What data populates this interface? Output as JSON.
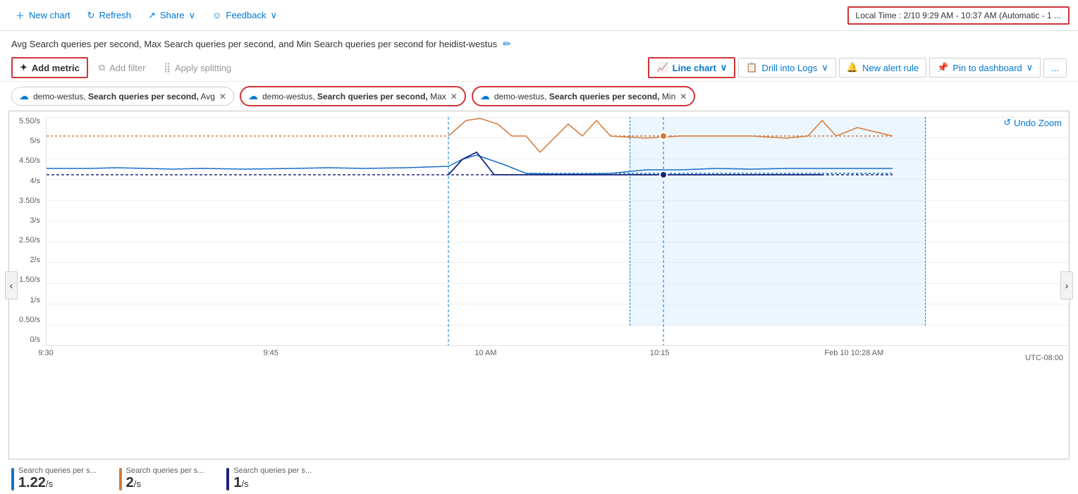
{
  "toolbar": {
    "new_chart": "New chart",
    "refresh": "Refresh",
    "share": "Share",
    "feedback": "Feedback",
    "time_range": "Local Time : 2/10 9:29 AM - 10:37 AM (Automatic - 1 ..."
  },
  "title": {
    "text": "Avg Search queries per second, Max Search queries per second, and Min Search queries per second for heidist-westus",
    "edit_icon": "✏"
  },
  "metrics_toolbar": {
    "add_metric": "Add metric",
    "add_filter": "Add filter",
    "apply_splitting": "Apply splitting",
    "line_chart": "Line chart",
    "drill_into_logs": "Drill into Logs",
    "new_alert_rule": "New alert rule",
    "pin_to_dashboard": "Pin to dashboard",
    "more": "..."
  },
  "metric_tags": [
    {
      "resource": "demo-westus",
      "metric": "Search queries per second",
      "agg": "Avg",
      "highlighted": false
    },
    {
      "resource": "demo-westus",
      "metric": "Search queries per second",
      "agg": "Max",
      "highlighted": true
    },
    {
      "resource": "demo-westus",
      "metric": "Search queries per second",
      "agg": "Min",
      "highlighted": true
    }
  ],
  "chart": {
    "undo_zoom": "Undo Zoom",
    "y_labels": [
      "5.50/s",
      "5/s",
      "4.50/s",
      "4/s",
      "3.50/s",
      "3/s",
      "2.50/s",
      "2/s",
      "1.50/s",
      "1/s",
      "0.50/s",
      "0/s"
    ],
    "x_labels": [
      {
        "label": "9:30",
        "pct": 0
      },
      {
        "label": "9:45",
        "pct": 20
      },
      {
        "label": "10 AM",
        "pct": 40
      },
      {
        "label": "10:15",
        "pct": 60
      },
      {
        "label": "Feb 10 10:28 AM",
        "pct": 80
      },
      {
        "label": "UTC-08:00",
        "pct": 98
      }
    ],
    "utc_label": "UTC-08:00"
  },
  "legend": [
    {
      "color": "#1b6fc7",
      "title": "Search queries per s...",
      "value": "1.22",
      "unit": "/s"
    },
    {
      "color": "#d47a3a",
      "title": "Search queries per s...",
      "value": "2",
      "unit": "/s"
    },
    {
      "color": "#1a237e",
      "title": "Search queries per s...",
      "value": "1",
      "unit": "/s"
    }
  ],
  "nav": {
    "left": "‹",
    "right": "›"
  }
}
